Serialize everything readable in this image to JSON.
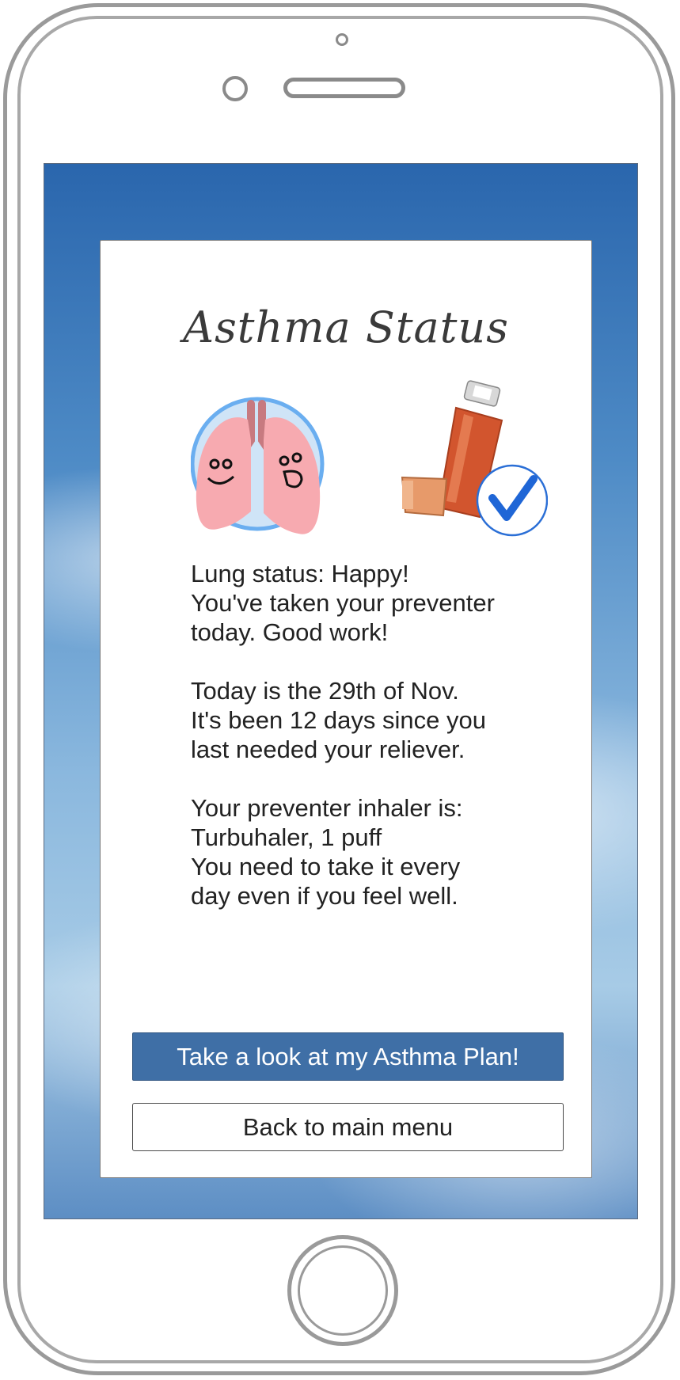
{
  "app": {
    "title": "Asthma Status"
  },
  "illustrations": {
    "lungs_icon": "happy-lungs-icon",
    "inhaler_icon": "inhaler-icon",
    "check_icon": "checkmark-icon"
  },
  "status": {
    "lung_line": "Lung status: Happy!",
    "preventer_line1": "You've taken your preventer",
    "preventer_line2": "today. Good work!",
    "date_line": "Today is the 29th of Nov.",
    "reliever_line1": "It's been 12 days since you",
    "reliever_line2": "last needed your reliever.",
    "inhaler_line1": "Your preventer inhaler is:",
    "inhaler_line2": "Turbuhaler, 1 puff",
    "inhaler_line3": "You need to take it every",
    "inhaler_line4": "day even if you feel well."
  },
  "buttons": {
    "primary_label": "Take a look at my Asthma Plan!",
    "secondary_label": "Back to main menu"
  },
  "colors": {
    "primary_button": "#3f6fa6",
    "lung_pink": "#f7aab0",
    "check_blue": "#1f66d6"
  }
}
